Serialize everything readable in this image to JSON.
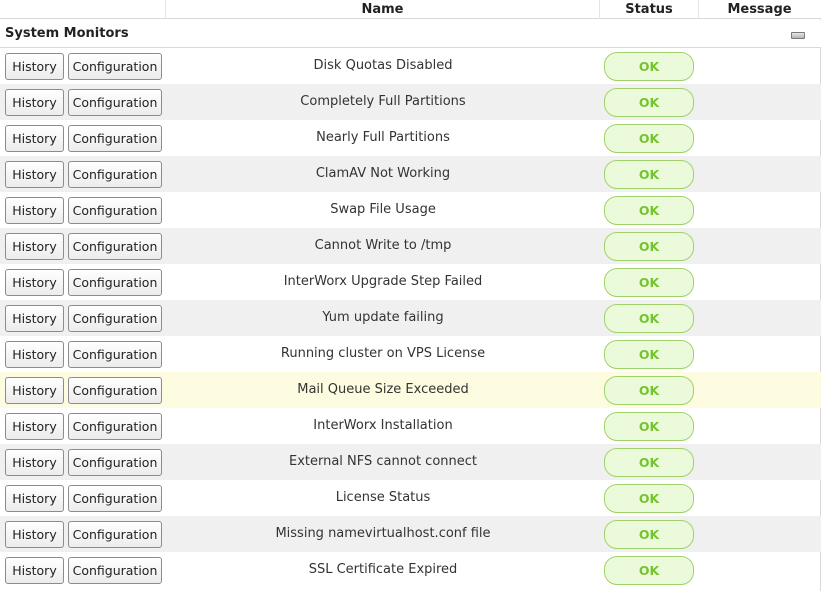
{
  "columns": {
    "name": "Name",
    "status": "Status",
    "message": "Message"
  },
  "section": {
    "title": "System Monitors"
  },
  "labels": {
    "history": "History",
    "configuration": "Configuration"
  },
  "rows": [
    {
      "name": "Disk Quotas Disabled",
      "status": "OK",
      "message": ""
    },
    {
      "name": "Completely Full Partitions",
      "status": "OK",
      "message": ""
    },
    {
      "name": "Nearly Full Partitions",
      "status": "OK",
      "message": ""
    },
    {
      "name": "ClamAV Not Working",
      "status": "OK",
      "message": ""
    },
    {
      "name": "Swap File Usage",
      "status": "OK",
      "message": ""
    },
    {
      "name": "Cannot Write to /tmp",
      "status": "OK",
      "message": ""
    },
    {
      "name": "InterWorx Upgrade Step Failed",
      "status": "OK",
      "message": ""
    },
    {
      "name": "Yum update failing",
      "status": "OK",
      "message": ""
    },
    {
      "name": "Running cluster on VPS License",
      "status": "OK",
      "message": ""
    },
    {
      "name": "Mail Queue Size Exceeded",
      "status": "OK",
      "message": ""
    },
    {
      "name": "InterWorx Installation",
      "status": "OK",
      "message": ""
    },
    {
      "name": "External NFS cannot connect",
      "status": "OK",
      "message": ""
    },
    {
      "name": "License Status",
      "status": "OK",
      "message": ""
    },
    {
      "name": "Missing namevirtualhost.conf file",
      "status": "OK",
      "message": ""
    },
    {
      "name": "SSL Certificate Expired",
      "status": "OK",
      "message": ""
    }
  ],
  "colors": {
    "ok_text": "#76c32f",
    "ok_border": "#9fd36a",
    "ok_background": "#ecfadc",
    "row_alt": "#f0f0f0",
    "row_highlight": "#fdfbe0"
  }
}
